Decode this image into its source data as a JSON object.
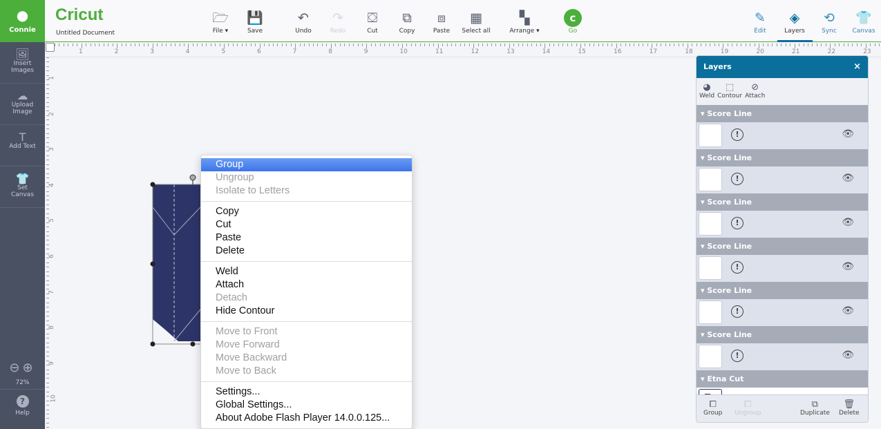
{
  "user": {
    "name": "Connie",
    "icon": "user-icon"
  },
  "app": {
    "logo": "Cricut",
    "document_title": "Untitled Document"
  },
  "toolbar": [
    {
      "label": "File ▾",
      "icon": "folder-icon",
      "glyph": "🗁",
      "enabled": true
    },
    {
      "label": "Save",
      "icon": "save-icon",
      "glyph": "💾",
      "enabled": true
    },
    {
      "label": "Undo",
      "icon": "undo-icon",
      "glyph": "↶",
      "enabled": true
    },
    {
      "label": "Redo",
      "icon": "redo-icon",
      "glyph": "↷",
      "enabled": false
    },
    {
      "label": "Cut",
      "icon": "cut-icon",
      "glyph": "⛋",
      "enabled": true
    },
    {
      "label": "Copy",
      "icon": "copy-icon",
      "glyph": "⧉",
      "enabled": true
    },
    {
      "label": "Paste",
      "icon": "paste-icon",
      "glyph": "⧈",
      "enabled": true
    },
    {
      "label": "Select all",
      "icon": "select-all-icon",
      "glyph": "▦",
      "enabled": true
    },
    {
      "label": "Arrange ▾",
      "icon": "arrange-icon",
      "glyph": "▚",
      "enabled": true
    },
    {
      "label": "Go",
      "icon": "go-icon",
      "glyph": "c",
      "enabled": true
    }
  ],
  "panels": [
    {
      "label": "Edit",
      "icon": "edit-icon",
      "glyph": "✎",
      "state": "normal"
    },
    {
      "label": "Layers",
      "icon": "layers-icon",
      "glyph": "◈",
      "state": "active"
    },
    {
      "label": "Sync",
      "icon": "sync-icon",
      "glyph": "⟲",
      "state": "normal"
    },
    {
      "label": "Canvas",
      "icon": "shirt-icon",
      "glyph": "👕",
      "state": "disabled"
    }
  ],
  "sidebar": [
    {
      "label": "Insert Images",
      "icon": "image-icon",
      "glyph": "🖼"
    },
    {
      "label": "Upload Image",
      "icon": "cloud-upload-icon",
      "glyph": "☁"
    },
    {
      "label": "Add Text",
      "icon": "text-icon",
      "glyph": "T"
    },
    {
      "label": "Set Canvas",
      "icon": "shirt-icon",
      "glyph": "👕"
    }
  ],
  "zoom": {
    "level": "72%"
  },
  "help": {
    "label": "Help"
  },
  "ruler": {
    "h": [
      "1",
      "2",
      "3",
      "4",
      "5",
      "6",
      "7",
      "8",
      "9",
      "10",
      "11",
      "12",
      "13",
      "14",
      "15",
      "16",
      "17",
      "18",
      "19",
      "20",
      "21",
      "22",
      "23"
    ],
    "v": [
      "1",
      "2",
      "3",
      "4",
      "5",
      "6",
      "7",
      "8",
      "9",
      "10"
    ]
  },
  "context_menu": [
    [
      {
        "label": "Group",
        "enabled": true,
        "selected": true
      },
      {
        "label": "Ungroup",
        "enabled": false
      },
      {
        "label": "Isolate to Letters",
        "enabled": false
      }
    ],
    [
      {
        "label": "Copy",
        "enabled": true
      },
      {
        "label": "Cut",
        "enabled": true
      },
      {
        "label": "Paste",
        "enabled": true
      },
      {
        "label": "Delete",
        "enabled": true
      }
    ],
    [
      {
        "label": "Weld",
        "enabled": true
      },
      {
        "label": "Attach",
        "enabled": true
      },
      {
        "label": "Detach",
        "enabled": false
      },
      {
        "label": "Hide Contour",
        "enabled": true
      }
    ],
    [
      {
        "label": "Move to Front",
        "enabled": false
      },
      {
        "label": "Move Forward",
        "enabled": false
      },
      {
        "label": "Move Backward",
        "enabled": false
      },
      {
        "label": "Move to Back",
        "enabled": false
      }
    ],
    [
      {
        "label": "Settings...",
        "enabled": true
      },
      {
        "label": "Global Settings...",
        "enabled": true
      },
      {
        "label": "About Adobe Flash Player 14.0.0.125...",
        "enabled": true
      }
    ]
  ],
  "layers_panel": {
    "title": "Layers",
    "close": "×",
    "tools": [
      {
        "label": "Weld",
        "icon": "weld-icon",
        "glyph": "◕"
      },
      {
        "label": "Contour",
        "icon": "contour-icon",
        "glyph": "⬚"
      },
      {
        "label": "Attach",
        "icon": "attach-icon",
        "glyph": "⊘"
      }
    ],
    "groups": [
      {
        "name": "Score Line"
      },
      {
        "name": "Score Line"
      },
      {
        "name": "Score Line"
      },
      {
        "name": "Score Line"
      },
      {
        "name": "Score Line"
      },
      {
        "name": "Score Line"
      },
      {
        "name": "Etna Cut"
      }
    ],
    "footer": [
      {
        "label": "Group",
        "icon": "group-icon",
        "glyph": "⧠",
        "enabled": true
      },
      {
        "label": "Ungroup",
        "icon": "ungroup-icon",
        "glyph": "⧠",
        "enabled": false
      },
      {
        "label": "Duplicate",
        "icon": "duplicate-icon",
        "glyph": "⧉",
        "enabled": true
      },
      {
        "label": "Delete",
        "icon": "trash-icon",
        "glyph": "🗑",
        "enabled": true
      }
    ]
  },
  "colors": {
    "brand": "#4caf3c",
    "accent": "#0b6f9c",
    "shape": "#2d3468",
    "sidebar": "#4a5163"
  }
}
